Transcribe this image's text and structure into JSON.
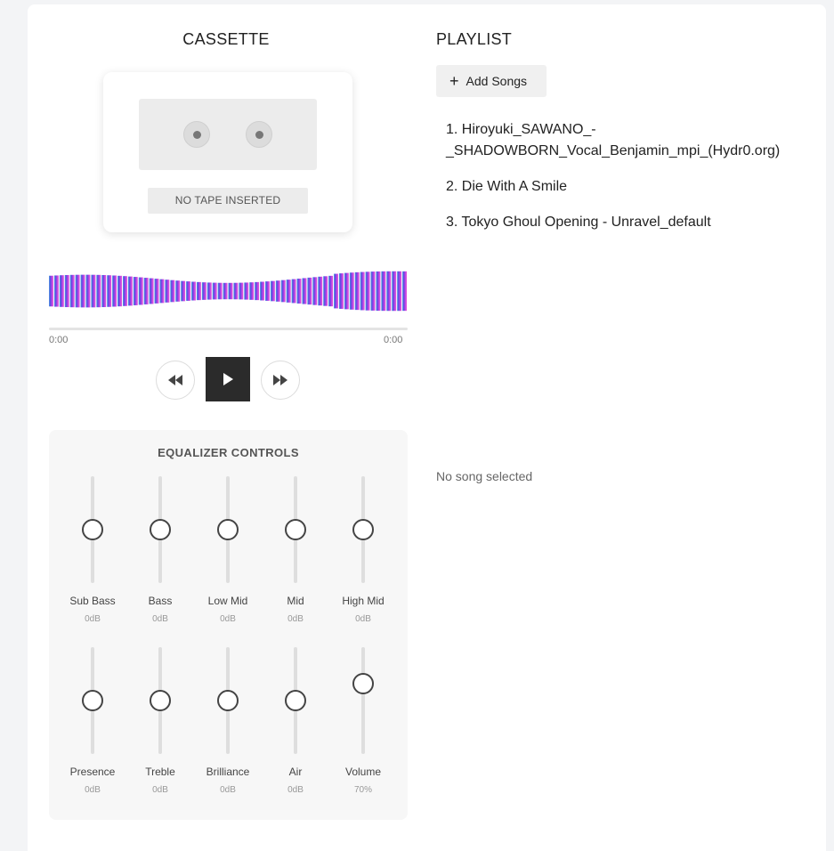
{
  "cassette": {
    "title": "CASSETTE",
    "tape_label": "NO TAPE INSERTED"
  },
  "player": {
    "time_current": "0:00",
    "time_total": "0:00",
    "progress": 0,
    "gradient_colors": [
      "#4aa8e0",
      "#5a55e0",
      "#8a3fe8",
      "#d04ee0",
      "#e050d8"
    ]
  },
  "equalizer": {
    "title": "EQUALIZER CONTROLS",
    "bands": [
      {
        "label": "Sub Bass",
        "value": "0dB",
        "level": 0.5
      },
      {
        "label": "Bass",
        "value": "0dB",
        "level": 0.5
      },
      {
        "label": "Low Mid",
        "value": "0dB",
        "level": 0.5
      },
      {
        "label": "Mid",
        "value": "0dB",
        "level": 0.5
      },
      {
        "label": "High Mid",
        "value": "0dB",
        "level": 0.5
      },
      {
        "label": "Presence",
        "value": "0dB",
        "level": 0.5
      },
      {
        "label": "Treble",
        "value": "0dB",
        "level": 0.5
      },
      {
        "label": "Brilliance",
        "value": "0dB",
        "level": 0.5
      },
      {
        "label": "Air",
        "value": "0dB",
        "level": 0.5
      },
      {
        "label": "Volume",
        "value": "70%",
        "level": 0.7
      }
    ]
  },
  "playlist": {
    "title": "PLAYLIST",
    "add_label": "Add Songs",
    "items": [
      "1. Hiroyuki_SAWANO_-_SHADOWBORN_Vocal_Benjamin_mpi_(Hydr0.org)",
      "2. Die With A Smile",
      "3. Tokyo Ghoul Opening - Unravel_default"
    ],
    "status": "No song selected"
  }
}
